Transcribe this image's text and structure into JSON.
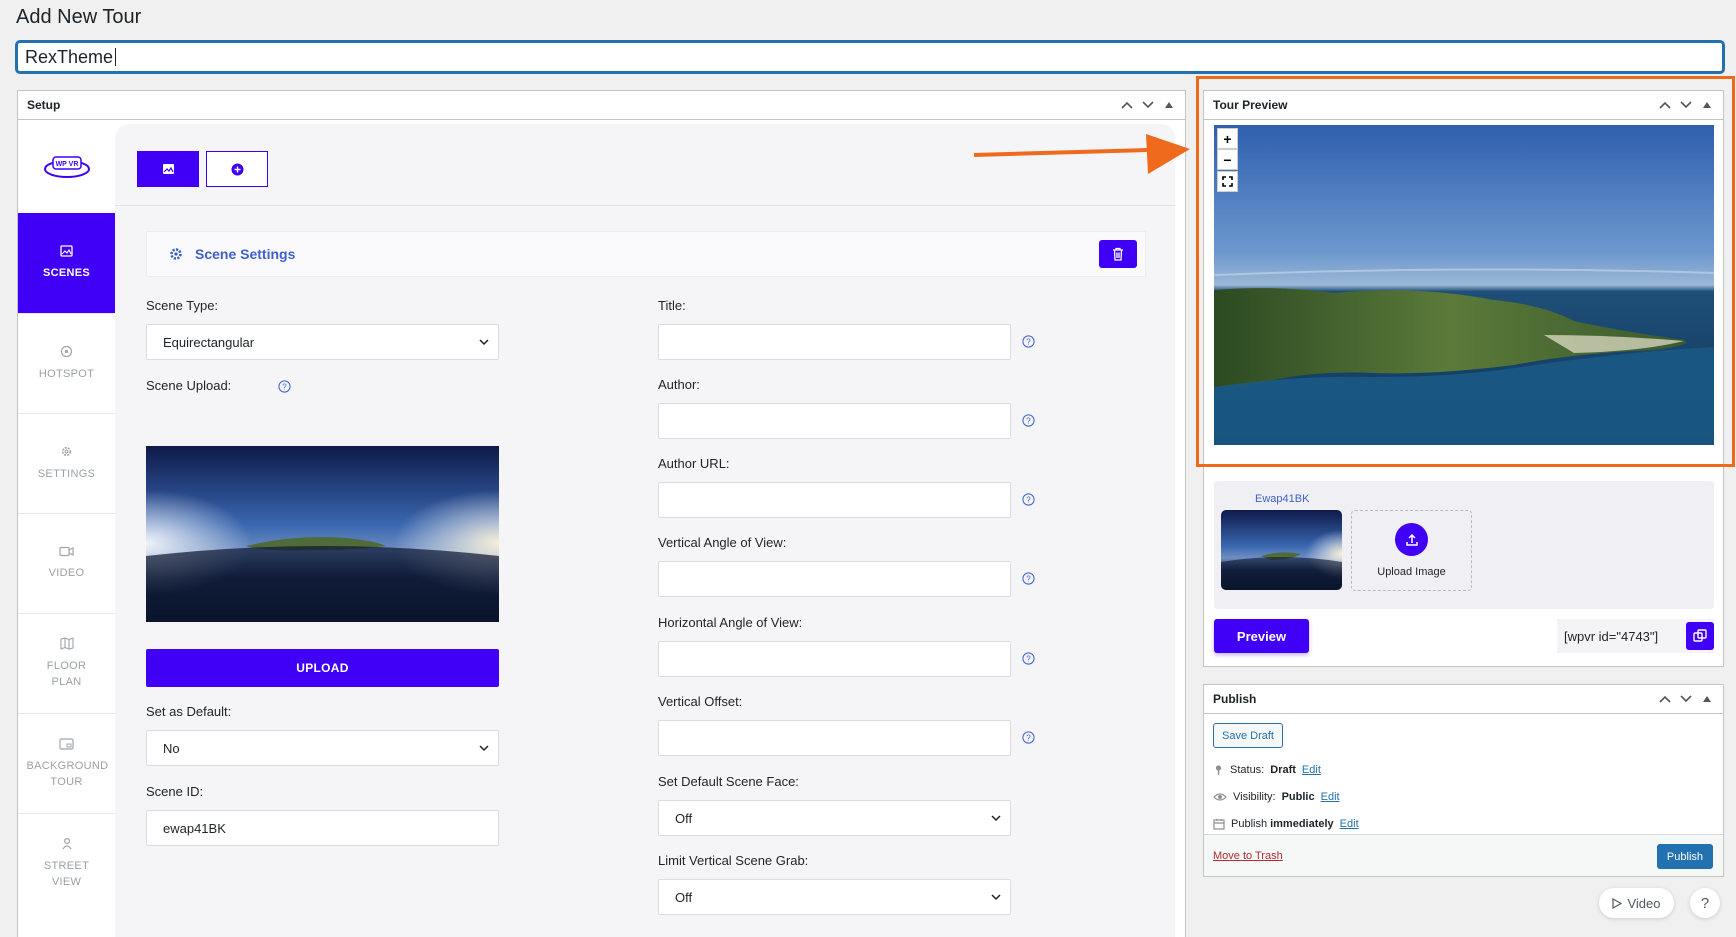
{
  "page": {
    "title": "Add New Tour",
    "post_title_value": "RexTheme"
  },
  "setup": {
    "title": "Setup",
    "logo_text": "WP VR",
    "sidebar": [
      {
        "label": "SCENES",
        "icon": "image-icon",
        "active": true
      },
      {
        "label": "HOTSPOT",
        "icon": "target-icon",
        "active": false
      },
      {
        "label": "SETTINGS",
        "icon": "gear-icon",
        "active": false
      },
      {
        "label": "VIDEO",
        "icon": "video-icon",
        "active": false
      },
      {
        "label": "FLOOR PLAN",
        "icon": "map-icon",
        "active": false
      },
      {
        "label": "BACKGROUND TOUR",
        "icon": "screen-icon",
        "active": false
      },
      {
        "label": "STREET VIEW",
        "icon": "person-pin-icon",
        "active": false
      }
    ],
    "scene_settings_label": "Scene Settings",
    "left_fields": {
      "scene_type_label": "Scene Type:",
      "scene_type_value": "Equirectangular",
      "scene_upload_label": "Scene Upload:",
      "upload_button": "UPLOAD",
      "set_default_label": "Set as Default:",
      "set_default_value": "No",
      "scene_id_label": "Scene ID:",
      "scene_id_value": "ewap41BK"
    },
    "right_fields": {
      "title_label": "Title:",
      "author_label": "Author:",
      "author_url_label": "Author URL:",
      "vertical_angle_label": "Vertical Angle of View:",
      "horizontal_angle_label": "Horizontal Angle of View:",
      "vertical_offset_label": "Vertical Offset:",
      "default_face_label": "Set Default Scene Face:",
      "default_face_value": "Off",
      "limit_grab_label": "Limit Vertical Scene Grab:",
      "limit_grab_value": "Off"
    }
  },
  "preview": {
    "title": "Tour Preview",
    "zoom_in": "+",
    "zoom_out": "−",
    "scene_id": "Ewap41BK",
    "upload_image_label": "Upload Image",
    "preview_button": "Preview",
    "shortcode": "[wpvr id=\"4743\"]"
  },
  "publish": {
    "title": "Publish",
    "save_draft": "Save Draft",
    "status_label": "Status:",
    "status_value": "Draft",
    "visibility_label": "Visibility:",
    "visibility_value": "Public",
    "publish_label": "Publish",
    "publish_value": "immediately",
    "edit_link": "Edit",
    "move_to_trash": "Move to Trash",
    "publish_button": "Publish"
  },
  "help": {
    "video_label": "Video",
    "help_label": "?"
  },
  "colors": {
    "accent": "#3f00f5",
    "wp_blue": "#2271b1",
    "highlight": "#f06a1d",
    "link_blue": "#3f5fcb"
  }
}
